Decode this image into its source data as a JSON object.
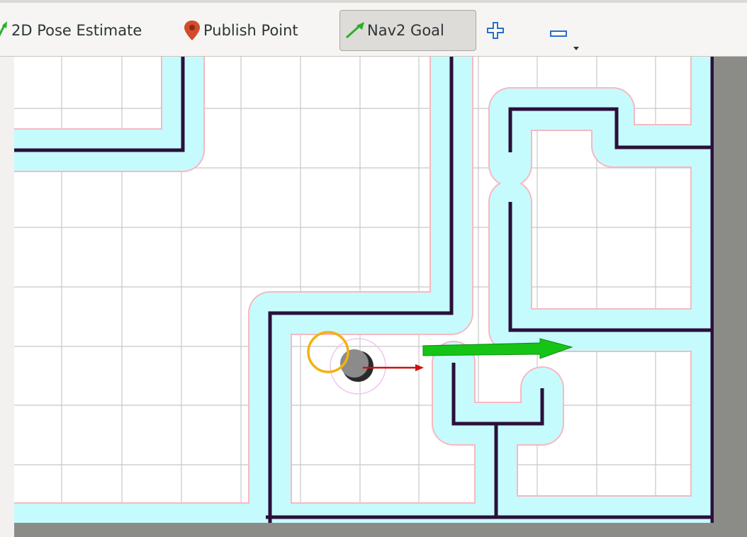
{
  "toolbar": {
    "tools": [
      {
        "label": "2D Pose Estimate",
        "icon": "pose-arrow-icon"
      },
      {
        "label": "Publish Point",
        "icon": "map-pin-icon"
      },
      {
        "label": "Nav2 Goal",
        "icon": "goal-arrow-icon",
        "active": true
      }
    ],
    "zoom_in": "plus-icon",
    "zoom_out": "minus-icon"
  },
  "map": {
    "colors": {
      "wall": "#2b0f3a",
      "inflation": "#c6fbfd",
      "inflation_edge": "#f7b8c0",
      "grid": "#c8c8c8",
      "unknown": "#8b8c88",
      "goal_arrow": "#16c416",
      "robot_heading": "#d01010",
      "robot_ring": "#f2b20f"
    }
  }
}
